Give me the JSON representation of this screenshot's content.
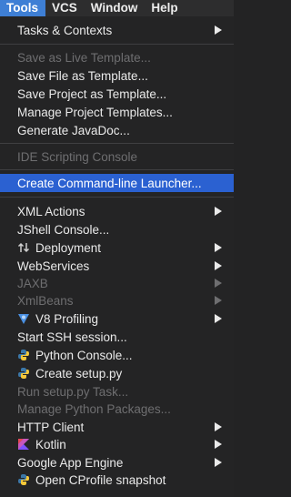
{
  "menubar": {
    "tools": "Tools",
    "vcs": "VCS",
    "window": "Window",
    "help": "Help"
  },
  "menu": {
    "tasks_contexts": "Tasks & Contexts",
    "save_as_live_template": "Save as Live Template...",
    "save_file_as_template": "Save File as Template...",
    "save_project_as_template": "Save Project as Template...",
    "manage_project_templates": "Manage Project Templates...",
    "generate_javadoc": "Generate JavaDoc...",
    "ide_scripting_console": "IDE Scripting Console",
    "create_command_line_launcher": "Create Command-line Launcher...",
    "xml_actions": "XML Actions",
    "jshell_console": "JShell Console...",
    "deployment": "Deployment",
    "webservices": "WebServices",
    "jaxb": "JAXB",
    "xmlbeans": "XmlBeans",
    "v8_profiling": "V8 Profiling",
    "start_ssh_session": "Start SSH session...",
    "python_console": "Python Console...",
    "create_setup_py": "Create setup.py",
    "run_setup_py_task": "Run setup.py Task...",
    "manage_python_packages": "Manage Python Packages...",
    "http_client": "HTTP Client",
    "kotlin": "Kotlin",
    "google_app_engine": "Google App Engine",
    "open_cprofile_snapshot": "Open CProfile snapshot"
  },
  "icons": {
    "deployment": "deployment-arrows-icon",
    "v8_profiling": "v8-profiling-icon",
    "python": "python-logo-icon",
    "kotlin": "kotlin-logo-icon",
    "submenu": "submenu-arrow-icon"
  },
  "colors": {
    "highlight": "#2b61d1",
    "menubar_active": "#3e7fd5",
    "text": "#eaeaea",
    "disabled_text": "#6e6e70",
    "background": "#242425"
  }
}
